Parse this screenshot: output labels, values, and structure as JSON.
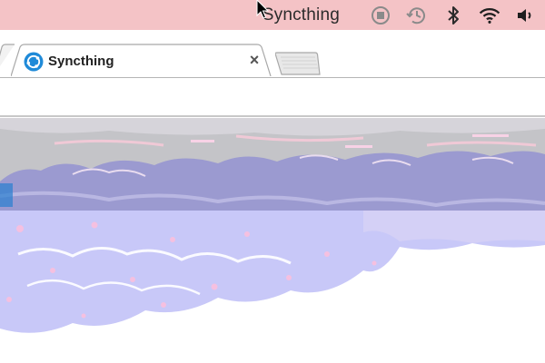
{
  "menubar": {
    "app_name": "Syncthing",
    "icons": [
      "stop-icon",
      "time-machine-icon",
      "bluetooth-icon",
      "wifi-icon",
      "volume-icon"
    ]
  },
  "browser": {
    "active_tab": {
      "title": "Syncthing",
      "favicon": "syncthing-logo-icon",
      "close_glyph": "×"
    }
  },
  "colors": {
    "menubar_bg": "#f4c3c6",
    "sky_band": "#c4c4c8",
    "clouds_dark": "#9b9ad0",
    "clouds_light": "#c8c8f8",
    "pink_highlights": "#f5c0e0",
    "favicon_blue": "#1f8ad8"
  }
}
